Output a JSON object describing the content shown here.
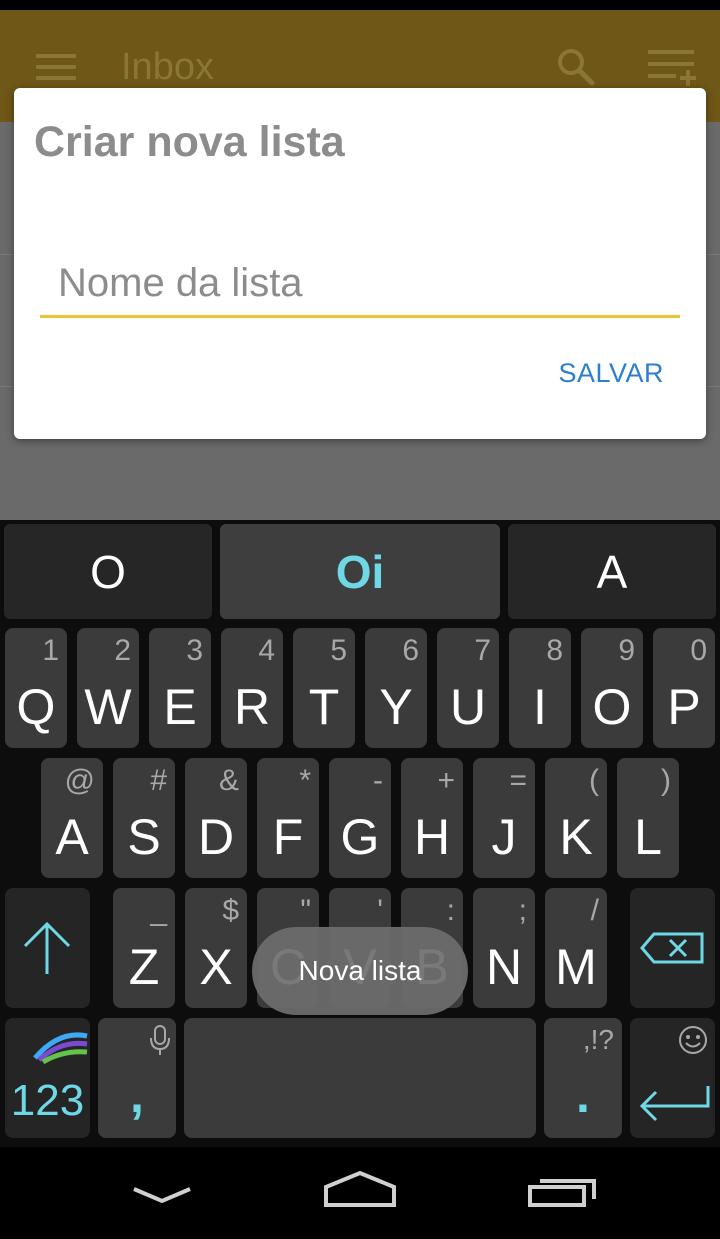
{
  "appbar": {
    "title": "Inbox"
  },
  "dialog": {
    "title": "Criar nova lista",
    "input_placeholder": "Nome da lista",
    "input_value": "",
    "save_label": "SALVAR"
  },
  "suggestions": [
    "O",
    "Oi",
    "A"
  ],
  "keys": {
    "row1": [
      {
        "main": "Q",
        "alt": "1"
      },
      {
        "main": "W",
        "alt": "2"
      },
      {
        "main": "E",
        "alt": "3"
      },
      {
        "main": "R",
        "alt": "4"
      },
      {
        "main": "T",
        "alt": "5"
      },
      {
        "main": "Y",
        "alt": "6"
      },
      {
        "main": "U",
        "alt": "7"
      },
      {
        "main": "I",
        "alt": "8"
      },
      {
        "main": "O",
        "alt": "9"
      },
      {
        "main": "P",
        "alt": "0"
      }
    ],
    "row2": [
      {
        "main": "A",
        "alt": "@"
      },
      {
        "main": "S",
        "alt": "#"
      },
      {
        "main": "D",
        "alt": "&"
      },
      {
        "main": "F",
        "alt": "*"
      },
      {
        "main": "G",
        "alt": "-"
      },
      {
        "main": "H",
        "alt": "+"
      },
      {
        "main": "J",
        "alt": "="
      },
      {
        "main": "K",
        "alt": "("
      },
      {
        "main": "L",
        "alt": ")"
      }
    ],
    "row3": [
      {
        "main": "Z",
        "alt": "_"
      },
      {
        "main": "X",
        "alt": "$"
      },
      {
        "main": "C",
        "alt": "\""
      },
      {
        "main": "V",
        "alt": "'"
      },
      {
        "main": "B",
        "alt": ":"
      },
      {
        "main": "N",
        "alt": ";"
      },
      {
        "main": "M",
        "alt": "/"
      }
    ],
    "num_label": "123",
    "comma": ",",
    "period": ".",
    "period_alt": ",!?"
  },
  "tooltip": "Nova lista",
  "colors": {
    "accent": "#f2c12e",
    "link": "#2b7fd1",
    "key_highlight": "#6ed8e6"
  }
}
